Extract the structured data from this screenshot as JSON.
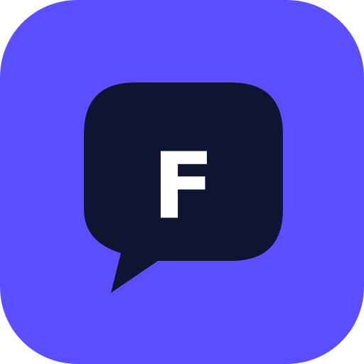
{
  "icon": {
    "name": "app-icon",
    "letter": "F",
    "colors": {
      "background": "#5B4EFF",
      "bubble": "#0F1433",
      "letter": "#FFFFFF"
    }
  }
}
